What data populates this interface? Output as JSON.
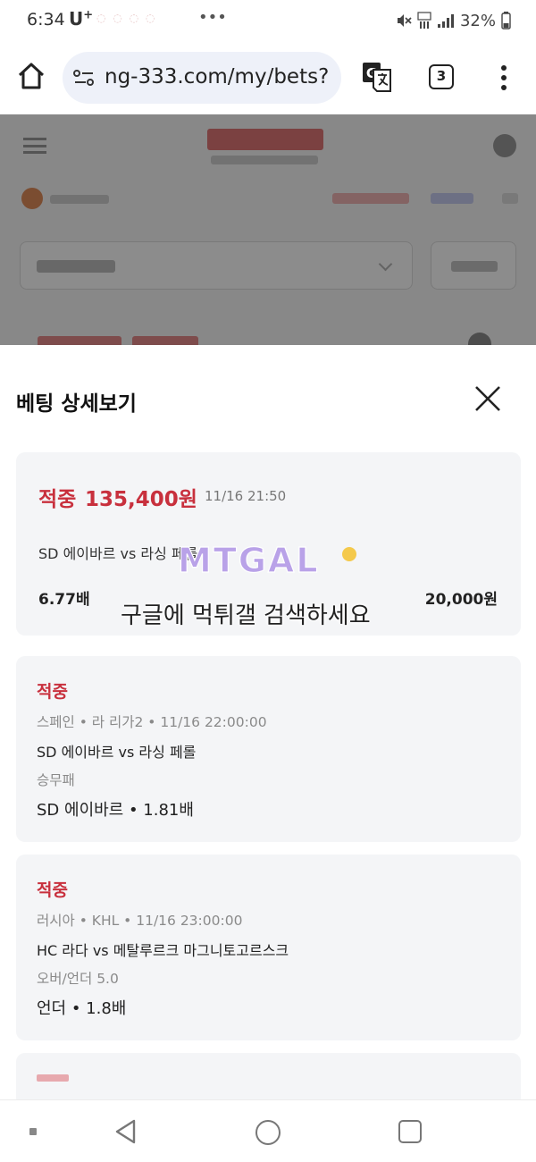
{
  "status_bar": {
    "time": "6:34",
    "carrier": "U",
    "carrier_sup": "+",
    "battery": "32%"
  },
  "browser": {
    "url": "ng-333.com/my/bets?",
    "tab_count": "3"
  },
  "modal": {
    "title": "베팅 상세보기",
    "summary": {
      "status": "적중",
      "amount": "135,400원",
      "datetime": "11/16 21:50",
      "match": "SD 에이바르 vs 라싱 페롤",
      "odds": "6.77배",
      "stake": "20,000원"
    },
    "bets": [
      {
        "status": "적중",
        "league": "스페인 • 라 리가2 • 11/16 22:00:00",
        "match": "SD 에이바르 vs 라싱 페롤",
        "market": "승무패",
        "pick": "SD 에이바르 • 1.81배"
      },
      {
        "status": "적중",
        "league": "러시아 • KHL • 11/16 23:00:00",
        "match": "HC 라다 vs 메탈루르크 마그니토고르스크",
        "market": "오버/언더 5.0",
        "pick": "언더 • 1.8배"
      }
    ]
  },
  "watermark": {
    "logo_text": "MTGAL",
    "caption": "구글에 먹튀갤 검색하세요"
  },
  "colors": {
    "accent_red": "#c8303d",
    "card_bg": "#f4f5f7",
    "url_bar_bg": "#eef1f9"
  },
  "icons": [
    "home-icon",
    "site-settings-icon",
    "translate-icon",
    "more-vert-icon",
    "close-icon",
    "nav-back-icon",
    "nav-home-icon",
    "nav-recents-icon"
  ]
}
